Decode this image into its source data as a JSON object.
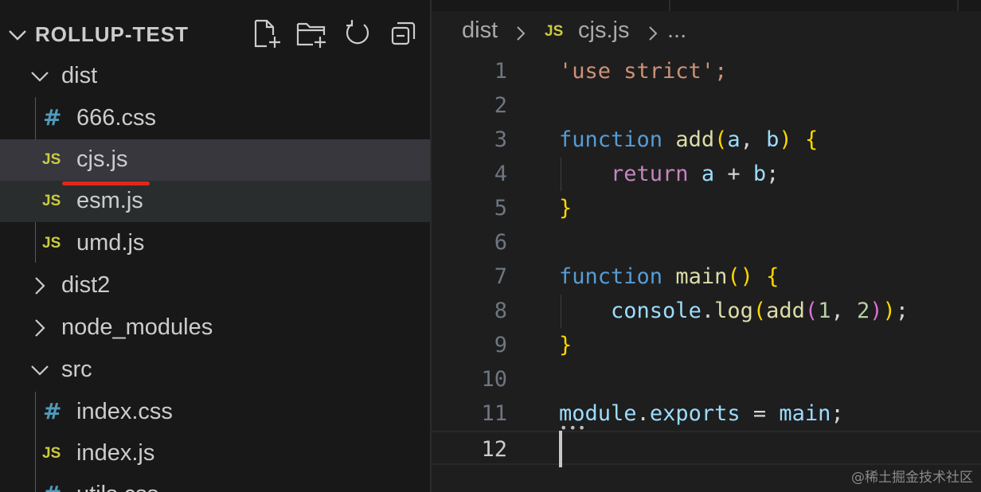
{
  "explorer": {
    "title": "ROLLUP-TEST",
    "actions": [
      {
        "name": "new-file-icon"
      },
      {
        "name": "new-folder-icon"
      },
      {
        "name": "refresh-icon"
      },
      {
        "name": "collapse-all-icon"
      }
    ],
    "items": [
      {
        "label": "dist",
        "kind": "folder",
        "expanded": true
      },
      {
        "label": "666.css",
        "kind": "css",
        "icon_text": "#"
      },
      {
        "label": "cjs.js",
        "kind": "js",
        "icon_text": "JS",
        "selected": true
      },
      {
        "label": "esm.js",
        "kind": "js",
        "icon_text": "JS"
      },
      {
        "label": "umd.js",
        "kind": "js",
        "icon_text": "JS"
      },
      {
        "label": "dist2",
        "kind": "folder",
        "expanded": false
      },
      {
        "label": "node_modules",
        "kind": "folder",
        "expanded": false
      },
      {
        "label": "src",
        "kind": "folder",
        "expanded": true
      },
      {
        "label": "index.css",
        "kind": "css",
        "icon_text": "#"
      },
      {
        "label": "index.js",
        "kind": "js",
        "icon_text": "JS"
      },
      {
        "label": "utils.css",
        "kind": "css",
        "icon_text": "#"
      }
    ]
  },
  "breadcrumb": {
    "folder": "dist",
    "file_icon": "JS",
    "file": "cjs.js",
    "more": "..."
  },
  "editor": {
    "line_numbers": [
      "1",
      "2",
      "3",
      "4",
      "5",
      "6",
      "7",
      "8",
      "9",
      "10",
      "11",
      "12"
    ],
    "active_line": "12",
    "lines": [
      "'use strict';",
      "",
      "function add(a, b) {",
      "    return a + b;",
      "}",
      "",
      "function main() {",
      "    console.log(add(1, 2));",
      "}",
      "",
      "module.exports = main;",
      ""
    ]
  },
  "watermark": "@稀土掘金技术社区",
  "colors": {
    "sidebar_bg": "#181818",
    "editor_bg": "#1e1e1e",
    "selected_row": "#37373d",
    "js_icon": "#cbcb41",
    "css_icon": "#519aba",
    "annotation_underline": "#e0261c"
  }
}
